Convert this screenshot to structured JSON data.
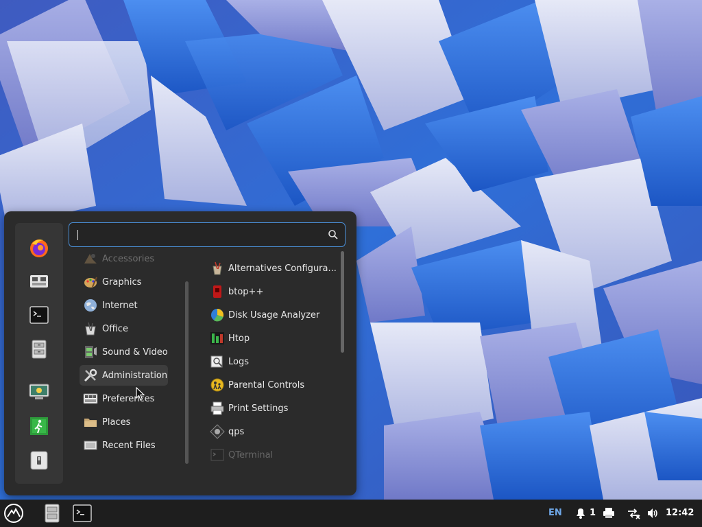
{
  "search": {
    "placeholder": "",
    "value": ""
  },
  "favorites": [
    {
      "name": "Firefox",
      "icon": "firefox-icon"
    },
    {
      "name": "System Settings",
      "icon": "settings-icon"
    },
    {
      "name": "Terminal",
      "icon": "terminal-icon"
    },
    {
      "name": "Files",
      "icon": "file-cabinet-icon"
    },
    {
      "name": "Lock Screen",
      "icon": "lock-screen-icon"
    },
    {
      "name": "Log Out",
      "icon": "logout-icon"
    },
    {
      "name": "Shut Down",
      "icon": "power-icon"
    }
  ],
  "categories": [
    {
      "label": "Accessories"
    },
    {
      "label": "Graphics"
    },
    {
      "label": "Internet"
    },
    {
      "label": "Office"
    },
    {
      "label": "Sound & Video"
    },
    {
      "label": "Administration"
    },
    {
      "label": "Preferences"
    },
    {
      "label": "Places"
    },
    {
      "label": "Recent Files"
    }
  ],
  "selected_category": "Administration",
  "apps": [
    {
      "label": "Alternatives Configura..."
    },
    {
      "label": "btop++"
    },
    {
      "label": "Disk Usage Analyzer"
    },
    {
      "label": "Htop"
    },
    {
      "label": "Logs"
    },
    {
      "label": "Parental Controls"
    },
    {
      "label": "Print Settings"
    },
    {
      "label": "qps"
    },
    {
      "label": "QTerminal"
    }
  ],
  "tray": {
    "language": "EN",
    "notification_count": "1",
    "clock": "12:42"
  },
  "colors": {
    "accent": "#4a8fd7",
    "panel": "#2b2b2b",
    "taskbar": "#1e1e1e",
    "language": "#6fa8e8"
  }
}
